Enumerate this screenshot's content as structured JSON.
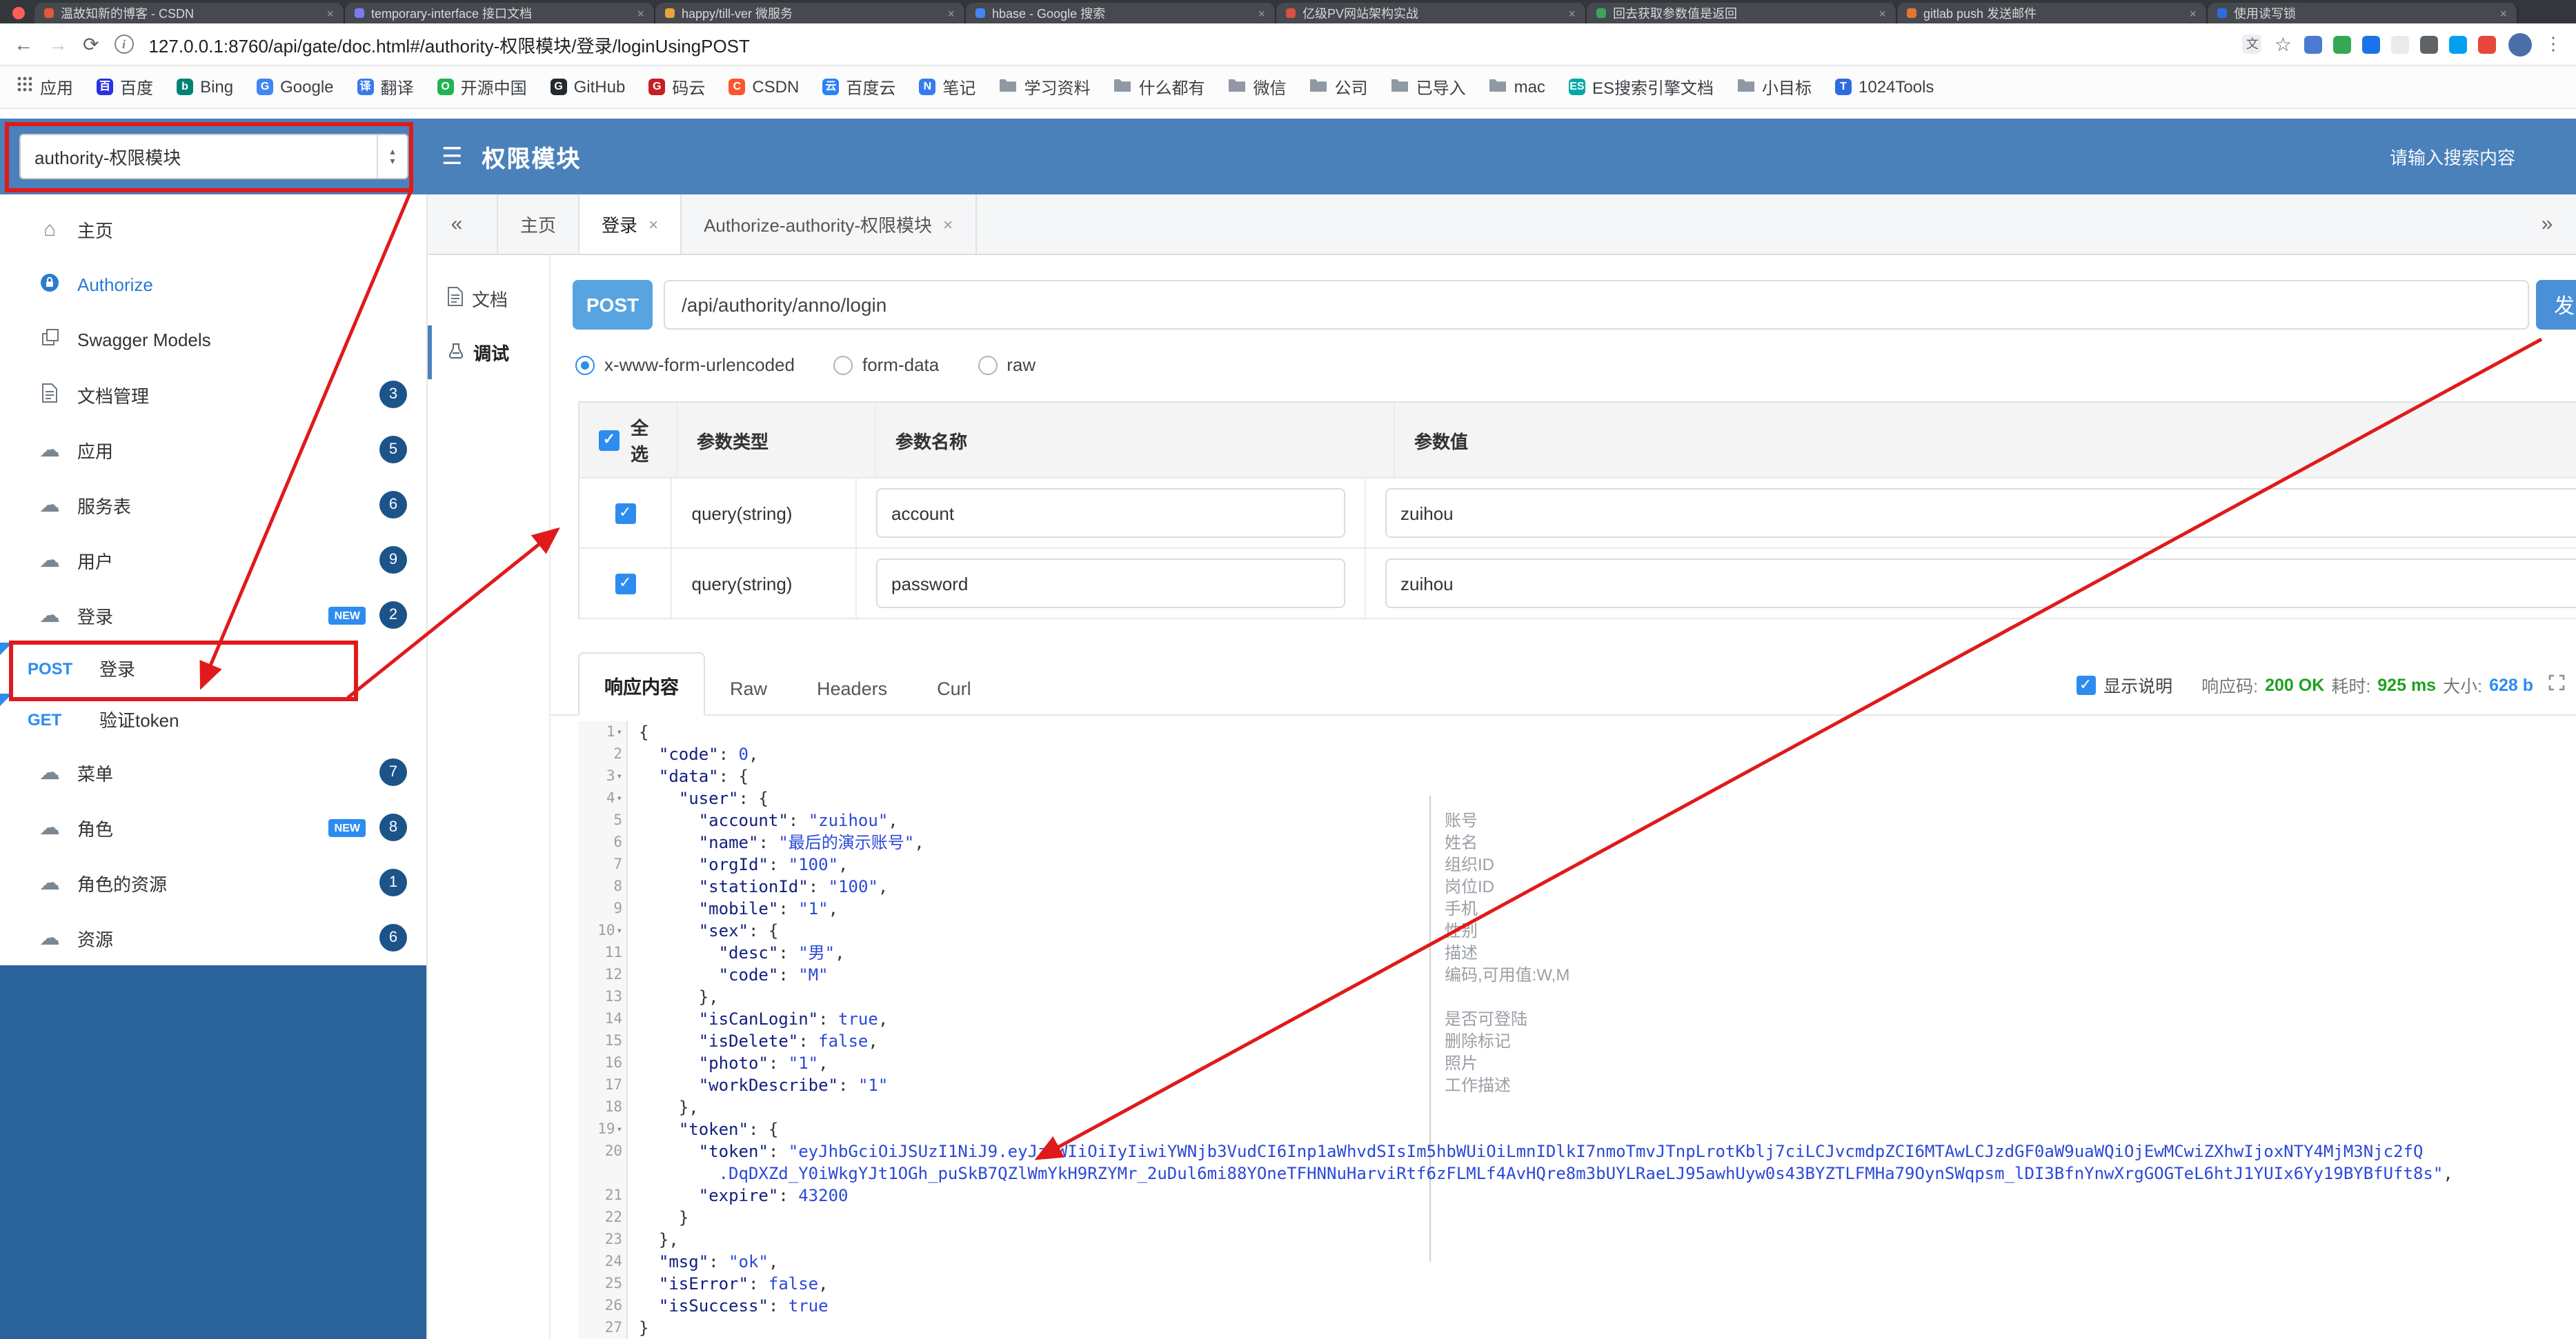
{
  "icons": {
    "back": "←",
    "forward": "→",
    "reload": "⟳",
    "info": "i",
    "star": "☆",
    "kebab": "⋮",
    "burger": "☰",
    "home": "⌂",
    "cloud": "☁",
    "caret_down": "▾",
    "caret_up": "▴",
    "check": "✓",
    "chevrons_left": "«",
    "chevrons_right": "»",
    "close": "×",
    "translate": "文"
  },
  "overlay": {
    "color": "#e01a1a"
  },
  "browser": {
    "traffic_light": "#ff5f57",
    "tabs": [
      {
        "label": "温故知新的博客 - CSDN",
        "color": "#e25a3a"
      },
      {
        "label": "temporary-interface 接口文档",
        "color": "#7b7bee"
      },
      {
        "label": "happy/till-ver 微服务",
        "color": "#e8a33d"
      },
      {
        "label": "hbase - Google 搜索",
        "color": "#4285f4"
      },
      {
        "label": "亿级PV网站架构实战",
        "color": "#d94f41"
      },
      {
        "label": "回去获取参数值是返回",
        "color": "#3ba55d"
      },
      {
        "label": "gitlab push 发送邮件",
        "color": "#e2762d"
      },
      {
        "label": "使用读写锁",
        "color": "#2d6ce0"
      }
    ],
    "url": "127.0.0.1:8760/api/gate/doc.html#/authority-权限模块/登录/loginUsingPOST",
    "ext_icons": [
      "#4a7bd0",
      "#34a853",
      "#1a73e8",
      "#e8eaed",
      "#5f6368",
      "#00a1f1",
      "#e8453c"
    ],
    "avatar_color": "#4b6ea9",
    "bookmarks": [
      {
        "label": "应用",
        "icon": "apps"
      },
      {
        "label": "百度",
        "icon": "chip",
        "letter": "百",
        "color": "#2932e1"
      },
      {
        "label": "Bing",
        "icon": "chip",
        "letter": "b",
        "color": "#008373"
      },
      {
        "label": "Google",
        "icon": "chip",
        "letter": "G",
        "color": "#4285f4"
      },
      {
        "label": "翻译",
        "icon": "chip",
        "letter": "译",
        "color": "#3a7af0"
      },
      {
        "label": "开源中国",
        "icon": "chip",
        "letter": "O",
        "color": "#21b351"
      },
      {
        "label": "GitHub",
        "icon": "chip",
        "letter": "G",
        "color": "#24292e"
      },
      {
        "label": "码云",
        "icon": "chip",
        "letter": "G",
        "color": "#c71d23"
      },
      {
        "label": "CSDN",
        "icon": "chip",
        "letter": "C",
        "color": "#fc5531"
      },
      {
        "label": "百度云",
        "icon": "chip",
        "letter": "云",
        "color": "#2b82f7"
      },
      {
        "label": "笔记",
        "icon": "chip",
        "letter": "N",
        "color": "#3a7af0"
      },
      {
        "label": "学习资料",
        "icon": "folder"
      },
      {
        "label": "什么都有",
        "icon": "folder"
      },
      {
        "label": "微信",
        "icon": "folder"
      },
      {
        "label": "公司",
        "icon": "folder"
      },
      {
        "label": "已导入",
        "icon": "folder"
      },
      {
        "label": "mac",
        "icon": "folder"
      },
      {
        "label": "ES搜索引擎文档",
        "icon": "chip",
        "letter": "ES",
        "color": "#00a9a5"
      },
      {
        "label": "小目标",
        "icon": "folder"
      },
      {
        "label": "1024Tools",
        "icon": "chip",
        "letter": "T",
        "color": "#2d6ce0"
      }
    ]
  },
  "header": {
    "module_select": "authority-权限模块",
    "title": "权限模块",
    "search_placeholder": "请输入搜索内容"
  },
  "sidebar": {
    "new_label": "NEW",
    "items": [
      {
        "label": "主页",
        "icon": "home"
      },
      {
        "label": "Authorize",
        "icon": "authorize",
        "accent": true
      },
      {
        "label": "Swagger Models",
        "icon": "models"
      },
      {
        "label": "文档管理",
        "icon": "docs",
        "badge": "3"
      },
      {
        "label": "应用",
        "icon": "cloud",
        "badge": "5"
      },
      {
        "label": "服务表",
        "icon": "cloud",
        "badge": "6"
      },
      {
        "label": "用户",
        "icon": "cloud",
        "badge": "9"
      },
      {
        "label": "登录",
        "icon": "cloud",
        "badge": "2",
        "new": true
      },
      {
        "method": "POST",
        "label": "登录"
      },
      {
        "method": "GET",
        "label": "验证token"
      },
      {
        "label": "菜单",
        "icon": "cloud",
        "badge": "7"
      },
      {
        "label": "角色",
        "icon": "cloud",
        "badge": "8",
        "new": true
      },
      {
        "label": "角色的资源",
        "icon": "cloud",
        "badge": "1"
      },
      {
        "label": "资源",
        "icon": "cloud",
        "badge": "6"
      }
    ]
  },
  "tabbar": {
    "tabs": [
      {
        "label": "主页",
        "closable": false,
        "active": false
      },
      {
        "label": "登录",
        "closable": true,
        "active": true
      },
      {
        "label": "Authorize-authority-权限模块",
        "closable": true,
        "active": false
      }
    ]
  },
  "doc_nav": {
    "doc": "文档",
    "debug": "调试"
  },
  "endpoint": {
    "method": "POST",
    "path": "/api/authority/anno/login",
    "send_label": "发"
  },
  "content_types": [
    {
      "label": "x-www-form-urlencoded",
      "selected": true
    },
    {
      "label": "form-data",
      "selected": false
    },
    {
      "label": "raw",
      "selected": false
    }
  ],
  "params_table": {
    "select_all": "全选",
    "headers": [
      "参数类型",
      "参数名称",
      "参数值"
    ],
    "rows": [
      {
        "checked": true,
        "type": "query(string)",
        "name": "account",
        "value": "zuihou"
      },
      {
        "checked": true,
        "type": "query(string)",
        "name": "password",
        "value": "zuihou"
      }
    ]
  },
  "response": {
    "tabs": [
      "响应内容",
      "Raw",
      "Headers",
      "Curl"
    ],
    "active": "响应内容",
    "show_desc": "显示说明",
    "status_label": "响应码:",
    "status_value": "200 OK",
    "time_label": "耗时:",
    "time_value": "925 ms",
    "size_label": "大小:",
    "size_value": "628 b"
  },
  "code": {
    "fold_lines": [
      1,
      3,
      4,
      10,
      19
    ],
    "lines": [
      {
        "n": 1,
        "seg": [
          [
            "{",
            "p"
          ]
        ]
      },
      {
        "n": 2,
        "seg": [
          [
            "  ",
            "p"
          ],
          [
            "\"code\"",
            "k"
          ],
          [
            ": ",
            "p"
          ],
          [
            "0",
            "n"
          ],
          [
            ",",
            "p"
          ]
        ]
      },
      {
        "n": 3,
        "seg": [
          [
            "  ",
            "p"
          ],
          [
            "\"data\"",
            "k"
          ],
          [
            ": {",
            "p"
          ]
        ]
      },
      {
        "n": 4,
        "seg": [
          [
            "    ",
            "p"
          ],
          [
            "\"user\"",
            "k"
          ],
          [
            ": {",
            "p"
          ]
        ]
      },
      {
        "n": 5,
        "seg": [
          [
            "      ",
            "p"
          ],
          [
            "\"account\"",
            "k"
          ],
          [
            ": ",
            "p"
          ],
          [
            "\"zuihou\"",
            "s"
          ],
          [
            ",",
            "p"
          ]
        ]
      },
      {
        "n": 6,
        "seg": [
          [
            "      ",
            "p"
          ],
          [
            "\"name\"",
            "k"
          ],
          [
            ": ",
            "p"
          ],
          [
            "\"最后的演示账号\"",
            "s"
          ],
          [
            ",",
            "p"
          ]
        ]
      },
      {
        "n": 7,
        "seg": [
          [
            "      ",
            "p"
          ],
          [
            "\"orgId\"",
            "k"
          ],
          [
            ": ",
            "p"
          ],
          [
            "\"100\"",
            "s"
          ],
          [
            ",",
            "p"
          ]
        ]
      },
      {
        "n": 8,
        "seg": [
          [
            "      ",
            "p"
          ],
          [
            "\"stationId\"",
            "k"
          ],
          [
            ": ",
            "p"
          ],
          [
            "\"100\"",
            "s"
          ],
          [
            ",",
            "p"
          ]
        ]
      },
      {
        "n": 9,
        "seg": [
          [
            "      ",
            "p"
          ],
          [
            "\"mobile\"",
            "k"
          ],
          [
            ": ",
            "p"
          ],
          [
            "\"1\"",
            "s"
          ],
          [
            ",",
            "p"
          ]
        ]
      },
      {
        "n": 10,
        "seg": [
          [
            "      ",
            "p"
          ],
          [
            "\"sex\"",
            "k"
          ],
          [
            ": {",
            "p"
          ]
        ]
      },
      {
        "n": 11,
        "seg": [
          [
            "        ",
            "p"
          ],
          [
            "\"desc\"",
            "k"
          ],
          [
            ": ",
            "p"
          ],
          [
            "\"男\"",
            "s"
          ],
          [
            ",",
            "p"
          ]
        ]
      },
      {
        "n": 12,
        "seg": [
          [
            "        ",
            "p"
          ],
          [
            "\"code\"",
            "k"
          ],
          [
            ": ",
            "p"
          ],
          [
            "\"M\"",
            "s"
          ]
        ]
      },
      {
        "n": 13,
        "seg": [
          [
            "      },",
            "p"
          ]
        ]
      },
      {
        "n": 14,
        "seg": [
          [
            "      ",
            "p"
          ],
          [
            "\"isCanLogin\"",
            "k"
          ],
          [
            ": ",
            "p"
          ],
          [
            "true",
            "b"
          ],
          [
            ",",
            "p"
          ]
        ]
      },
      {
        "n": 15,
        "seg": [
          [
            "      ",
            "p"
          ],
          [
            "\"isDelete\"",
            "k"
          ],
          [
            ": ",
            "p"
          ],
          [
            "false",
            "b"
          ],
          [
            ",",
            "p"
          ]
        ]
      },
      {
        "n": 16,
        "seg": [
          [
            "      ",
            "p"
          ],
          [
            "\"photo\"",
            "k"
          ],
          [
            ": ",
            "p"
          ],
          [
            "\"1\"",
            "s"
          ],
          [
            ",",
            "p"
          ]
        ]
      },
      {
        "n": 17,
        "seg": [
          [
            "      ",
            "p"
          ],
          [
            "\"workDescribe\"",
            "k"
          ],
          [
            ": ",
            "p"
          ],
          [
            "\"1\"",
            "s"
          ]
        ]
      },
      {
        "n": 18,
        "seg": [
          [
            "    },",
            "p"
          ]
        ]
      },
      {
        "n": 19,
        "seg": [
          [
            "    ",
            "p"
          ],
          [
            "\"token\"",
            "k"
          ],
          [
            ": {",
            "p"
          ]
        ]
      },
      {
        "n": 20,
        "seg": [
          [
            "      ",
            "p"
          ],
          [
            "\"token\"",
            "k"
          ],
          [
            ": ",
            "p"
          ],
          [
            "\"eyJhbGciOiJSUzI1NiJ9.eyJzdWIiOiIyIiwiYWNjb3VudCI6Inp1aWhvdSIsIm5hbWUiOiLmnIDlkI7nmoTmvJTnpLrotKblj7ciLCJvcmdpZCI6MTAwLCJzdGF0aW9uaWQiOjEwMCwiZXhwIjoxNTY4MjM3Njc2fQ",
            "s"
          ],
          [
            "\n        ",
            "p"
          ],
          [
            ".DqDXZd_Y0iWkgYJt1OGh_puSkB7QZlWmYkH9RZYMr_2uDul6mi88YOneTFHNNuHarviRtf6zFLMLf4AvHQre8m3bUYLRaeLJ95awhUyw0s43BYZTLFMHa79OynSWqpsm_lDI3BfnYnwXrgGOGTeL6htJ1YUIx6Yy19BYBfUft8s\"",
            "s"
          ],
          [
            ",",
            "p"
          ]
        ]
      },
      {
        "n": 21,
        "seg": [
          [
            "      ",
            "p"
          ],
          [
            "\"expire\"",
            "k"
          ],
          [
            ": ",
            "p"
          ],
          [
            "43200",
            "n"
          ]
        ]
      },
      {
        "n": 22,
        "seg": [
          [
            "    }",
            "p"
          ]
        ]
      },
      {
        "n": 23,
        "seg": [
          [
            "  },",
            "p"
          ]
        ]
      },
      {
        "n": 24,
        "seg": [
          [
            "  ",
            "p"
          ],
          [
            "\"msg\"",
            "k"
          ],
          [
            ": ",
            "p"
          ],
          [
            "\"ok\"",
            "s"
          ],
          [
            ",",
            "p"
          ]
        ]
      },
      {
        "n": 25,
        "seg": [
          [
            "  ",
            "p"
          ],
          [
            "\"isError\"",
            "k"
          ],
          [
            ": ",
            "p"
          ],
          [
            "false",
            "b"
          ],
          [
            ",",
            "p"
          ]
        ]
      },
      {
        "n": 26,
        "seg": [
          [
            "  ",
            "p"
          ],
          [
            "\"isSuccess\"",
            "k"
          ],
          [
            ": ",
            "p"
          ],
          [
            "true",
            "b"
          ]
        ]
      },
      {
        "n": 27,
        "seg": [
          [
            "}",
            "p"
          ]
        ]
      }
    ],
    "annotations": [
      [
        5,
        "账号"
      ],
      [
        6,
        "姓名"
      ],
      [
        7,
        "组织ID"
      ],
      [
        8,
        "岗位ID"
      ],
      [
        9,
        "手机"
      ],
      [
        10,
        "性别"
      ],
      [
        11,
        "描述"
      ],
      [
        12,
        "编码,可用值:W,M"
      ],
      [
        14,
        "是否可登陆"
      ],
      [
        15,
        "删除标记"
      ],
      [
        16,
        "照片"
      ],
      [
        17,
        "工作描述"
      ]
    ]
  }
}
